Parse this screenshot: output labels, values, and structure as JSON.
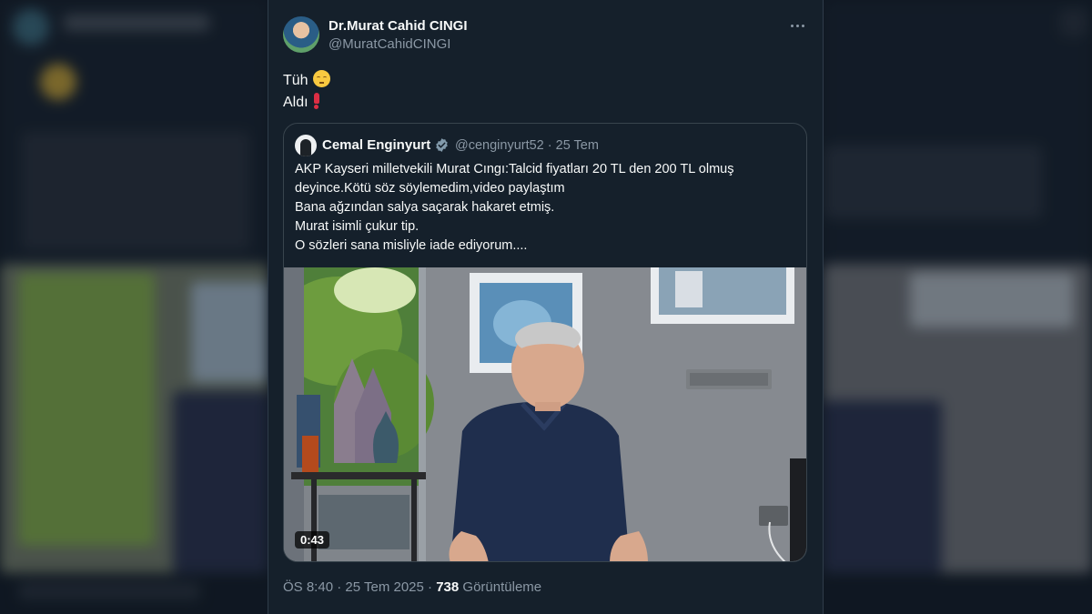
{
  "tweet": {
    "author_name": "Dr.Murat Cahid CINGI",
    "author_handle": "@MuratCahidCINGI",
    "line1": "Tüh",
    "line2": "Aldı",
    "more_icon": "more-horizontal-icon"
  },
  "quote": {
    "author_name": "Cemal Enginyurt",
    "author_handle": "@cenginyurt52",
    "date": "25 Tem",
    "verified_color": "#829aab",
    "lines": [
      "AKP Kayseri milletvekili Murat Cıngı:Talcid fiyatları 20 TL den 200 TL olmuş",
      "deyince.Kötü söz söylemedim,video paylaştım",
      "Bana ağzından salya saçarak hakaret etmiş.",
      "Murat isimli çukur tip.",
      "O sözleri sana misliyle iade ediyorum...."
    ],
    "video_duration": "0:43"
  },
  "footer": {
    "time": "ÖS 8:40",
    "date": "25 Tem 2025",
    "views_count": "738",
    "views_label": "Görüntüleme"
  },
  "colors": {
    "background": "#15202b",
    "primary_text": "#f7f9f9",
    "secondary_text": "#8b98a5",
    "border": "#38444d"
  }
}
